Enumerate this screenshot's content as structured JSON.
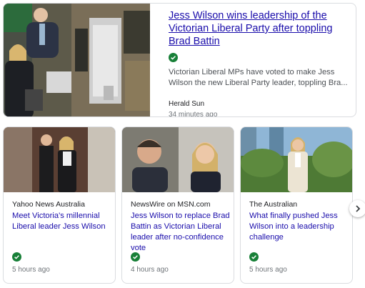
{
  "top_story": {
    "title": "Jess Wilson wins leadership of the Victorian Liberal Party after toppling Brad Battin",
    "snippet": "Victorian Liberal MPs have voted to make Jess Wilson the new Liberal Party leader, toppling Bra...",
    "source": "Herald Sun",
    "time": "34 minutes ago",
    "image_icon": "parliament-photo"
  },
  "cards": [
    {
      "source": "Yahoo News Australia",
      "headline": "Meet Victoria's millennial Liberal leader Jess Wilson",
      "time": "5 hours ago"
    },
    {
      "source": "NewsWire on MSN.com",
      "headline": "Jess Wilson to replace Brad Battin as Victorian Liberal leader after no-confidence vote",
      "time": "4 hours ago"
    },
    {
      "source": "The Australian",
      "headline": "What finally pushed Jess Wilson into a leadership challenge",
      "time": "5 hours ago"
    }
  ],
  "colors": {
    "link": "#1a0dab",
    "check": "#188038"
  },
  "next_icon": "chevron-right-icon"
}
